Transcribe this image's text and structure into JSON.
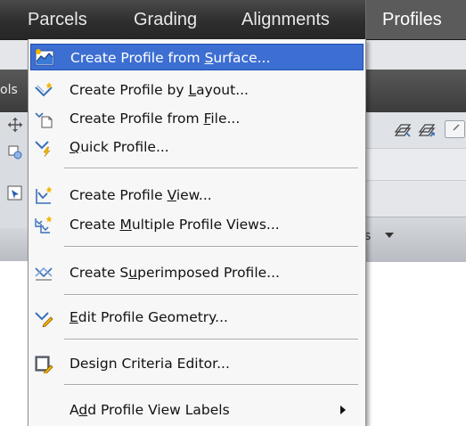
{
  "menubar": {
    "items": [
      {
        "label": "Parcels"
      },
      {
        "label": "Grading"
      },
      {
        "label": "Alignments"
      },
      {
        "label": "Profiles",
        "state": "open"
      }
    ]
  },
  "background": {
    "left_tab_label": "ols",
    "panel_label": "s"
  },
  "profiles_menu": {
    "items": [
      {
        "pre": "Create Profile from ",
        "key": "S",
        "post": "urface...",
        "icon": "profile-from-surface-icon",
        "highlighted": true
      },
      {
        "pre": "Create Profile by ",
        "key": "L",
        "post": "ayout...",
        "icon": "profile-by-layout-icon"
      },
      {
        "pre": "Create Profile from ",
        "key": "F",
        "post": "ile...",
        "icon": "profile-from-file-icon"
      },
      {
        "pre": "",
        "key": "Q",
        "post": "uick Profile...",
        "icon": "quick-profile-icon"
      },
      {
        "pre": "Create Profile ",
        "key": "V",
        "post": "iew...",
        "icon": "create-profile-view-icon"
      },
      {
        "pre": "Create ",
        "key": "M",
        "post": "ultiple Profile Views...",
        "icon": "multiple-profile-views-icon"
      },
      {
        "pre": "Create S",
        "key": "u",
        "post": "perimposed Profile...",
        "icon": "superimposed-profile-icon"
      },
      {
        "pre": "",
        "key": "E",
        "post": "dit Profile Geometry...",
        "icon": "edit-profile-geometry-icon"
      },
      {
        "pre": "Design Criteria Editor...",
        "key": "",
        "post": "",
        "icon": "design-criteria-editor-icon"
      },
      {
        "pre": "A",
        "key": "d",
        "post": "d Profile View Labels",
        "icon": "",
        "submenu": true
      }
    ]
  },
  "colors": {
    "menubar": "#3a3a3a",
    "highlight": "#3d6fd2",
    "menu_bg": "#f7f7f7"
  }
}
